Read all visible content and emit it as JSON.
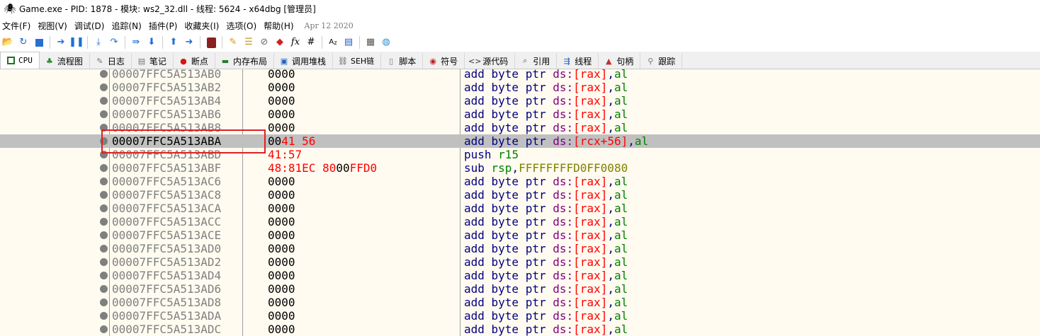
{
  "window": {
    "title": "Game.exe - PID: 1878 - 模块: ws2_32.dll - 线程: 5624 - x64dbg [管理员]"
  },
  "menu": {
    "items": [
      "文件(F)",
      "视图(V)",
      "调试(D)",
      "追踪(N)",
      "插件(P)",
      "收藏夹(I)",
      "选项(O)",
      "帮助(H)"
    ],
    "date": "Apr 12 2020"
  },
  "toolbar": {
    "icons": [
      "open-icon",
      "restart-icon",
      "stop-icon",
      "run-icon",
      "pause-icon",
      "step-into-icon",
      "step-over-icon",
      "trace-into-icon",
      "trace-over-icon",
      "execute-till-return-icon",
      "run-to-user-code-icon",
      "scylla-icon",
      "patches-icon",
      "comments-icon",
      "labels-icon",
      "bookmarks-icon",
      "functions-icon",
      "variables-icon",
      "hash-icon",
      "strings-icon",
      "calculator-icon",
      "help-globe-icon"
    ]
  },
  "tabs": [
    {
      "icon": "cpu-icon",
      "label": "CPU"
    },
    {
      "icon": "graph-icon",
      "label": "流程图"
    },
    {
      "icon": "log-icon",
      "label": "日志"
    },
    {
      "icon": "notes-icon",
      "label": "笔记"
    },
    {
      "icon": "breakpoint-icon",
      "label": "断点"
    },
    {
      "icon": "memory-map-icon",
      "label": "内存布局"
    },
    {
      "icon": "call-stack-icon",
      "label": "调用堆栈"
    },
    {
      "icon": "seh-icon",
      "label": "SEH链"
    },
    {
      "icon": "script-icon",
      "label": "脚本"
    },
    {
      "icon": "symbols-icon",
      "label": "符号"
    },
    {
      "icon": "source-icon",
      "label": "源代码"
    },
    {
      "icon": "references-icon",
      "label": "引用"
    },
    {
      "icon": "threads-icon",
      "label": "线程"
    },
    {
      "icon": "handles-icon",
      "label": "句柄"
    },
    {
      "icon": "trace-icon",
      "label": "跟踪"
    }
  ],
  "selected_row": 5,
  "rows": [
    {
      "addr": "00007FFC5A513AB0",
      "bytes": [
        [
          "0000",
          "k"
        ]
      ],
      "instr": [
        [
          "add byte ptr ",
          "i"
        ],
        [
          "ds:",
          "s"
        ],
        [
          "[",
          "b"
        ],
        [
          "rax",
          "b"
        ],
        [
          "]",
          "b"
        ],
        [
          ",",
          "i"
        ],
        [
          "al",
          "g"
        ]
      ]
    },
    {
      "addr": "00007FFC5A513AB2",
      "bytes": [
        [
          "0000",
          "k"
        ]
      ],
      "instr": [
        [
          "add byte ptr ",
          "i"
        ],
        [
          "ds:",
          "s"
        ],
        [
          "[",
          "b"
        ],
        [
          "rax",
          "b"
        ],
        [
          "]",
          "b"
        ],
        [
          ",",
          "i"
        ],
        [
          "al",
          "g"
        ]
      ]
    },
    {
      "addr": "00007FFC5A513AB4",
      "bytes": [
        [
          "0000",
          "k"
        ]
      ],
      "instr": [
        [
          "add byte ptr ",
          "i"
        ],
        [
          "ds:",
          "s"
        ],
        [
          "[",
          "b"
        ],
        [
          "rax",
          "b"
        ],
        [
          "]",
          "b"
        ],
        [
          ",",
          "i"
        ],
        [
          "al",
          "g"
        ]
      ]
    },
    {
      "addr": "00007FFC5A513AB6",
      "bytes": [
        [
          "0000",
          "k"
        ]
      ],
      "instr": [
        [
          "add byte ptr ",
          "i"
        ],
        [
          "ds:",
          "s"
        ],
        [
          "[",
          "b"
        ],
        [
          "rax",
          "b"
        ],
        [
          "]",
          "b"
        ],
        [
          ",",
          "i"
        ],
        [
          "al",
          "g"
        ]
      ]
    },
    {
      "addr": "00007FFC5A513AB8",
      "bytes": [
        [
          "0000",
          "k"
        ]
      ],
      "instr": [
        [
          "add byte ptr ",
          "i"
        ],
        [
          "ds:",
          "s"
        ],
        [
          "[",
          "b"
        ],
        [
          "rax",
          "b"
        ],
        [
          "]",
          "b"
        ],
        [
          ",",
          "i"
        ],
        [
          "al",
          "g"
        ]
      ]
    },
    {
      "addr": "00007FFC5A513ABA",
      "bytes": [
        [
          "00",
          "k"
        ],
        [
          "41 56",
          "r"
        ]
      ],
      "instr": [
        [
          "add byte ptr ",
          "i"
        ],
        [
          "ds:",
          "s"
        ],
        [
          "[",
          "b"
        ],
        [
          "rcx+56",
          "b"
        ],
        [
          "]",
          "b"
        ],
        [
          ",",
          "i"
        ],
        [
          "al",
          "g"
        ]
      ]
    },
    {
      "addr": "00007FFC5A513ABD",
      "bytes": [
        [
          "41:57",
          "r"
        ]
      ],
      "instr": [
        [
          "push ",
          "i"
        ],
        [
          "r15",
          "g"
        ]
      ]
    },
    {
      "addr": "00007FFC5A513ABF",
      "bytes": [
        [
          "48:81EC 80",
          "r"
        ],
        [
          "00",
          "k"
        ],
        [
          "FFD0",
          "r"
        ]
      ],
      "instr": [
        [
          "sub ",
          "i"
        ],
        [
          "rsp",
          "g"
        ],
        [
          ",",
          "i"
        ],
        [
          "FFFFFFFFD0FF0080",
          "n"
        ]
      ]
    },
    {
      "addr": "00007FFC5A513AC6",
      "bytes": [
        [
          "0000",
          "k"
        ]
      ],
      "instr": [
        [
          "add byte ptr ",
          "i"
        ],
        [
          "ds:",
          "s"
        ],
        [
          "[",
          "b"
        ],
        [
          "rax",
          "b"
        ],
        [
          "]",
          "b"
        ],
        [
          ",",
          "i"
        ],
        [
          "al",
          "g"
        ]
      ]
    },
    {
      "addr": "00007FFC5A513AC8",
      "bytes": [
        [
          "0000",
          "k"
        ]
      ],
      "instr": [
        [
          "add byte ptr ",
          "i"
        ],
        [
          "ds:",
          "s"
        ],
        [
          "[",
          "b"
        ],
        [
          "rax",
          "b"
        ],
        [
          "]",
          "b"
        ],
        [
          ",",
          "i"
        ],
        [
          "al",
          "g"
        ]
      ]
    },
    {
      "addr": "00007FFC5A513ACA",
      "bytes": [
        [
          "0000",
          "k"
        ]
      ],
      "instr": [
        [
          "add byte ptr ",
          "i"
        ],
        [
          "ds:",
          "s"
        ],
        [
          "[",
          "b"
        ],
        [
          "rax",
          "b"
        ],
        [
          "]",
          "b"
        ],
        [
          ",",
          "i"
        ],
        [
          "al",
          "g"
        ]
      ]
    },
    {
      "addr": "00007FFC5A513ACC",
      "bytes": [
        [
          "0000",
          "k"
        ]
      ],
      "instr": [
        [
          "add byte ptr ",
          "i"
        ],
        [
          "ds:",
          "s"
        ],
        [
          "[",
          "b"
        ],
        [
          "rax",
          "b"
        ],
        [
          "]",
          "b"
        ],
        [
          ",",
          "i"
        ],
        [
          "al",
          "g"
        ]
      ]
    },
    {
      "addr": "00007FFC5A513ACE",
      "bytes": [
        [
          "0000",
          "k"
        ]
      ],
      "instr": [
        [
          "add byte ptr ",
          "i"
        ],
        [
          "ds:",
          "s"
        ],
        [
          "[",
          "b"
        ],
        [
          "rax",
          "b"
        ],
        [
          "]",
          "b"
        ],
        [
          ",",
          "i"
        ],
        [
          "al",
          "g"
        ]
      ]
    },
    {
      "addr": "00007FFC5A513AD0",
      "bytes": [
        [
          "0000",
          "k"
        ]
      ],
      "instr": [
        [
          "add byte ptr ",
          "i"
        ],
        [
          "ds:",
          "s"
        ],
        [
          "[",
          "b"
        ],
        [
          "rax",
          "b"
        ],
        [
          "]",
          "b"
        ],
        [
          ",",
          "i"
        ],
        [
          "al",
          "g"
        ]
      ]
    },
    {
      "addr": "00007FFC5A513AD2",
      "bytes": [
        [
          "0000",
          "k"
        ]
      ],
      "instr": [
        [
          "add byte ptr ",
          "i"
        ],
        [
          "ds:",
          "s"
        ],
        [
          "[",
          "b"
        ],
        [
          "rax",
          "b"
        ],
        [
          "]",
          "b"
        ],
        [
          ",",
          "i"
        ],
        [
          "al",
          "g"
        ]
      ]
    },
    {
      "addr": "00007FFC5A513AD4",
      "bytes": [
        [
          "0000",
          "k"
        ]
      ],
      "instr": [
        [
          "add byte ptr ",
          "i"
        ],
        [
          "ds:",
          "s"
        ],
        [
          "[",
          "b"
        ],
        [
          "rax",
          "b"
        ],
        [
          "]",
          "b"
        ],
        [
          ",",
          "i"
        ],
        [
          "al",
          "g"
        ]
      ]
    },
    {
      "addr": "00007FFC5A513AD6",
      "bytes": [
        [
          "0000",
          "k"
        ]
      ],
      "instr": [
        [
          "add byte ptr ",
          "i"
        ],
        [
          "ds:",
          "s"
        ],
        [
          "[",
          "b"
        ],
        [
          "rax",
          "b"
        ],
        [
          "]",
          "b"
        ],
        [
          ",",
          "i"
        ],
        [
          "al",
          "g"
        ]
      ]
    },
    {
      "addr": "00007FFC5A513AD8",
      "bytes": [
        [
          "0000",
          "k"
        ]
      ],
      "instr": [
        [
          "add byte ptr ",
          "i"
        ],
        [
          "ds:",
          "s"
        ],
        [
          "[",
          "b"
        ],
        [
          "rax",
          "b"
        ],
        [
          "]",
          "b"
        ],
        [
          ",",
          "i"
        ],
        [
          "al",
          "g"
        ]
      ]
    },
    {
      "addr": "00007FFC5A513ADA",
      "bytes": [
        [
          "0000",
          "k"
        ]
      ],
      "instr": [
        [
          "add byte ptr ",
          "i"
        ],
        [
          "ds:",
          "s"
        ],
        [
          "[",
          "b"
        ],
        [
          "rax",
          "b"
        ],
        [
          "]",
          "b"
        ],
        [
          ",",
          "i"
        ],
        [
          "al",
          "g"
        ]
      ]
    },
    {
      "addr": "00007FFC5A513ADC",
      "bytes": [
        [
          "0000",
          "k"
        ]
      ],
      "instr": [
        [
          "add byte ptr ",
          "i"
        ],
        [
          "ds:",
          "s"
        ],
        [
          "[",
          "b"
        ],
        [
          "rax",
          "b"
        ],
        [
          "]",
          "b"
        ],
        [
          ",",
          "i"
        ],
        [
          "al",
          "g"
        ]
      ]
    }
  ]
}
